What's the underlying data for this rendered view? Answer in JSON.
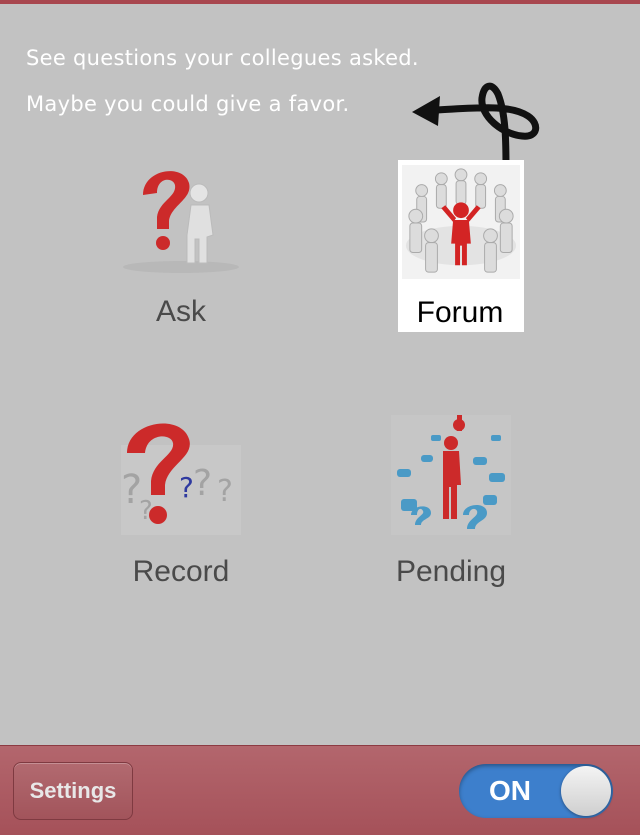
{
  "hint": {
    "line1": "See questions your collegues asked.",
    "line2": "Maybe you could give a favor."
  },
  "tiles": {
    "ask": {
      "label": "Ask",
      "icon": "question-mark-thinking-figure-icon"
    },
    "forum": {
      "label": "Forum",
      "icon": "people-circle-icon"
    },
    "record": {
      "label": "Record",
      "icon": "many-question-marks-icon"
    },
    "pending": {
      "label": "Pending",
      "icon": "figure-among-question-marks-icon"
    }
  },
  "bottom_bar": {
    "settings_label": "Settings",
    "toggle_label": "ON",
    "toggle_state": "on"
  },
  "colors": {
    "background": "#c2c2c2",
    "bar": "#a8555d",
    "toggle_on": "#3d7fcc",
    "accent_red": "#d32f2f"
  }
}
